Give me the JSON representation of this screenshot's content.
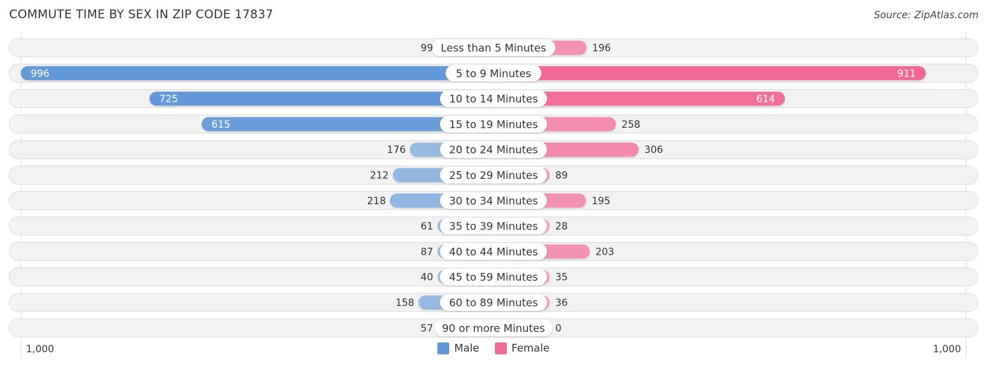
{
  "header": {
    "title": "COMMUTE TIME BY SEX IN ZIP CODE 17837",
    "source": "Source: ZipAtlas.com"
  },
  "colors": {
    "male": "#6399d8",
    "male_light": "#a6c5e8",
    "female": "#f06893",
    "female_light": "#f6a3bd",
    "track": "#f2f2f2"
  },
  "legend": [
    {
      "label": "Male",
      "color": "#6399d8"
    },
    {
      "label": "Female",
      "color": "#f06893"
    }
  ],
  "axis": {
    "left_label": "1,000",
    "right_label": "1,000"
  },
  "chart_data": {
    "type": "bar",
    "orientation": "horizontal-diverging",
    "title": "COMMUTE TIME BY SEX IN ZIP CODE 17837",
    "categories": [
      "Less than 5 Minutes",
      "5 to 9 Minutes",
      "10 to 14 Minutes",
      "15 to 19 Minutes",
      "20 to 24 Minutes",
      "25 to 29 Minutes",
      "30 to 34 Minutes",
      "35 to 39 Minutes",
      "40 to 44 Minutes",
      "45 to 59 Minutes",
      "60 to 89 Minutes",
      "90 or more Minutes"
    ],
    "series": [
      {
        "name": "Male",
        "values": [
          99,
          996,
          725,
          615,
          176,
          212,
          218,
          61,
          87,
          40,
          158,
          57
        ]
      },
      {
        "name": "Female",
        "values": [
          196,
          911,
          614,
          258,
          306,
          89,
          195,
          28,
          203,
          35,
          36,
          0
        ]
      }
    ],
    "xlim": [
      -1000,
      1000
    ],
    "tick_labels": [
      "1,000",
      "1,000"
    ],
    "legend_position": "bottom-center",
    "grid": false
  }
}
